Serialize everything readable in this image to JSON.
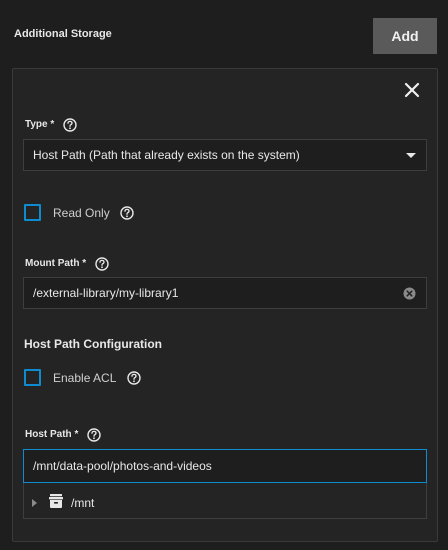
{
  "header": {
    "title": "Additional Storage",
    "add_label": "Add"
  },
  "form": {
    "type": {
      "label": "Type *",
      "value": "Host Path (Path that already exists on the system)"
    },
    "read_only": {
      "label": "Read Only",
      "checked": false
    },
    "mount_path": {
      "label": "Mount Path *",
      "value": "/external-library/my-library1"
    },
    "host_path_config": {
      "heading": "Host Path Configuration"
    },
    "enable_acl": {
      "label": "Enable ACL",
      "checked": false
    },
    "host_path": {
      "label": "Host Path *",
      "value": "/mnt/data-pool/photos-and-videos"
    },
    "tree": {
      "root_label": "/mnt"
    }
  },
  "colors": {
    "accent": "#0f8ccf",
    "background": "#1e1e1e",
    "card": "#242424",
    "add_button": "#5a5a5a"
  }
}
